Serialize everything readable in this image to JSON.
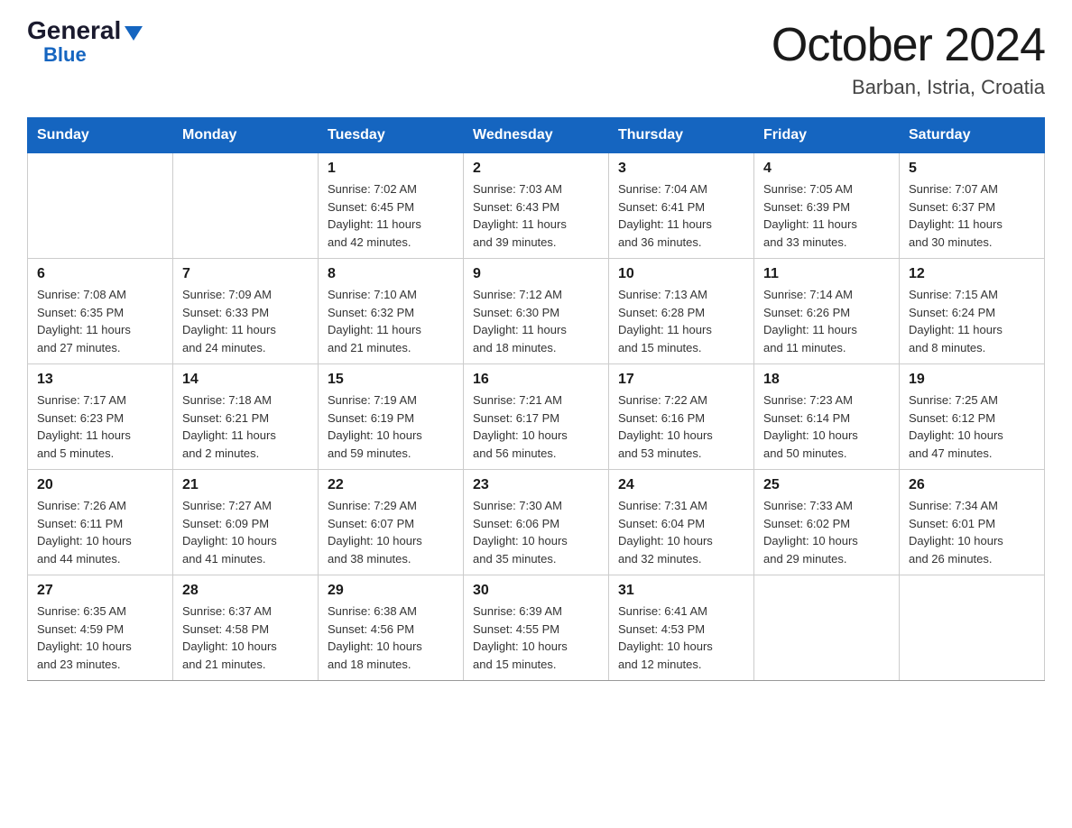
{
  "logo": {
    "general": "General",
    "triangle": "▶",
    "blue": "Blue"
  },
  "title": "October 2024",
  "subtitle": "Barban, Istria, Croatia",
  "weekdays": [
    "Sunday",
    "Monday",
    "Tuesday",
    "Wednesday",
    "Thursday",
    "Friday",
    "Saturday"
  ],
  "weeks": [
    [
      {
        "day": "",
        "info": ""
      },
      {
        "day": "",
        "info": ""
      },
      {
        "day": "1",
        "info": "Sunrise: 7:02 AM\nSunset: 6:45 PM\nDaylight: 11 hours\nand 42 minutes."
      },
      {
        "day": "2",
        "info": "Sunrise: 7:03 AM\nSunset: 6:43 PM\nDaylight: 11 hours\nand 39 minutes."
      },
      {
        "day": "3",
        "info": "Sunrise: 7:04 AM\nSunset: 6:41 PM\nDaylight: 11 hours\nand 36 minutes."
      },
      {
        "day": "4",
        "info": "Sunrise: 7:05 AM\nSunset: 6:39 PM\nDaylight: 11 hours\nand 33 minutes."
      },
      {
        "day": "5",
        "info": "Sunrise: 7:07 AM\nSunset: 6:37 PM\nDaylight: 11 hours\nand 30 minutes."
      }
    ],
    [
      {
        "day": "6",
        "info": "Sunrise: 7:08 AM\nSunset: 6:35 PM\nDaylight: 11 hours\nand 27 minutes."
      },
      {
        "day": "7",
        "info": "Sunrise: 7:09 AM\nSunset: 6:33 PM\nDaylight: 11 hours\nand 24 minutes."
      },
      {
        "day": "8",
        "info": "Sunrise: 7:10 AM\nSunset: 6:32 PM\nDaylight: 11 hours\nand 21 minutes."
      },
      {
        "day": "9",
        "info": "Sunrise: 7:12 AM\nSunset: 6:30 PM\nDaylight: 11 hours\nand 18 minutes."
      },
      {
        "day": "10",
        "info": "Sunrise: 7:13 AM\nSunset: 6:28 PM\nDaylight: 11 hours\nand 15 minutes."
      },
      {
        "day": "11",
        "info": "Sunrise: 7:14 AM\nSunset: 6:26 PM\nDaylight: 11 hours\nand 11 minutes."
      },
      {
        "day": "12",
        "info": "Sunrise: 7:15 AM\nSunset: 6:24 PM\nDaylight: 11 hours\nand 8 minutes."
      }
    ],
    [
      {
        "day": "13",
        "info": "Sunrise: 7:17 AM\nSunset: 6:23 PM\nDaylight: 11 hours\nand 5 minutes."
      },
      {
        "day": "14",
        "info": "Sunrise: 7:18 AM\nSunset: 6:21 PM\nDaylight: 11 hours\nand 2 minutes."
      },
      {
        "day": "15",
        "info": "Sunrise: 7:19 AM\nSunset: 6:19 PM\nDaylight: 10 hours\nand 59 minutes."
      },
      {
        "day": "16",
        "info": "Sunrise: 7:21 AM\nSunset: 6:17 PM\nDaylight: 10 hours\nand 56 minutes."
      },
      {
        "day": "17",
        "info": "Sunrise: 7:22 AM\nSunset: 6:16 PM\nDaylight: 10 hours\nand 53 minutes."
      },
      {
        "day": "18",
        "info": "Sunrise: 7:23 AM\nSunset: 6:14 PM\nDaylight: 10 hours\nand 50 minutes."
      },
      {
        "day": "19",
        "info": "Sunrise: 7:25 AM\nSunset: 6:12 PM\nDaylight: 10 hours\nand 47 minutes."
      }
    ],
    [
      {
        "day": "20",
        "info": "Sunrise: 7:26 AM\nSunset: 6:11 PM\nDaylight: 10 hours\nand 44 minutes."
      },
      {
        "day": "21",
        "info": "Sunrise: 7:27 AM\nSunset: 6:09 PM\nDaylight: 10 hours\nand 41 minutes."
      },
      {
        "day": "22",
        "info": "Sunrise: 7:29 AM\nSunset: 6:07 PM\nDaylight: 10 hours\nand 38 minutes."
      },
      {
        "day": "23",
        "info": "Sunrise: 7:30 AM\nSunset: 6:06 PM\nDaylight: 10 hours\nand 35 minutes."
      },
      {
        "day": "24",
        "info": "Sunrise: 7:31 AM\nSunset: 6:04 PM\nDaylight: 10 hours\nand 32 minutes."
      },
      {
        "day": "25",
        "info": "Sunrise: 7:33 AM\nSunset: 6:02 PM\nDaylight: 10 hours\nand 29 minutes."
      },
      {
        "day": "26",
        "info": "Sunrise: 7:34 AM\nSunset: 6:01 PM\nDaylight: 10 hours\nand 26 minutes."
      }
    ],
    [
      {
        "day": "27",
        "info": "Sunrise: 6:35 AM\nSunset: 4:59 PM\nDaylight: 10 hours\nand 23 minutes."
      },
      {
        "day": "28",
        "info": "Sunrise: 6:37 AM\nSunset: 4:58 PM\nDaylight: 10 hours\nand 21 minutes."
      },
      {
        "day": "29",
        "info": "Sunrise: 6:38 AM\nSunset: 4:56 PM\nDaylight: 10 hours\nand 18 minutes."
      },
      {
        "day": "30",
        "info": "Sunrise: 6:39 AM\nSunset: 4:55 PM\nDaylight: 10 hours\nand 15 minutes."
      },
      {
        "day": "31",
        "info": "Sunrise: 6:41 AM\nSunset: 4:53 PM\nDaylight: 10 hours\nand 12 minutes."
      },
      {
        "day": "",
        "info": ""
      },
      {
        "day": "",
        "info": ""
      }
    ]
  ]
}
